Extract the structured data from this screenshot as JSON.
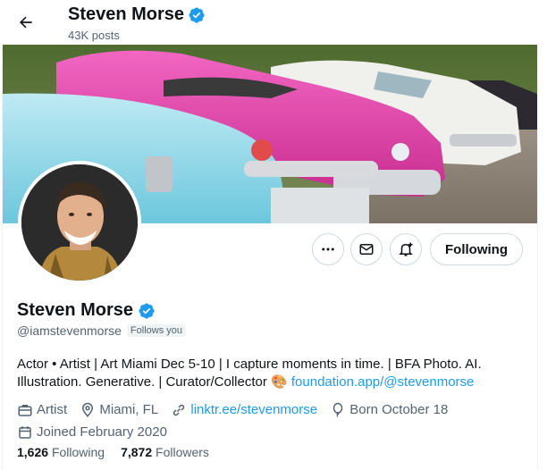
{
  "header": {
    "name": "Steven Morse",
    "posts": "43K posts"
  },
  "profile": {
    "name": "Steven Morse",
    "handle": "@iamstevenmorse",
    "follows_you": "Follows you",
    "bio_text": "Actor • Artist | Art Miami Dec 5-10 | I capture moments in time. | BFA Photo. AI. Illustration. Generative. | Curator/Collector",
    "bio_emoji": "🎨",
    "bio_link": "foundation.app/@stevenmorse",
    "meta": {
      "category": "Artist",
      "location": "Miami, FL",
      "website": "linktr.ee/stevenmorse",
      "born": "Born October 18",
      "joined": "Joined February 2020"
    },
    "stats": {
      "following_count": "1,626",
      "following_label": "Following",
      "followers_count": "7,872",
      "followers_label": "Followers"
    }
  },
  "actions": {
    "following_label": "Following"
  },
  "icons": [
    "back-arrow-icon",
    "verified-badge-icon",
    "more-icon",
    "message-icon",
    "notification-add-icon",
    "briefcase-icon",
    "location-icon",
    "link-icon",
    "balloon-icon",
    "calendar-icon"
  ],
  "colors": {
    "accent": "#1d9bf0",
    "secondary_text": "#536471",
    "primary_text": "#0f1419",
    "border": "#cfd9de"
  }
}
